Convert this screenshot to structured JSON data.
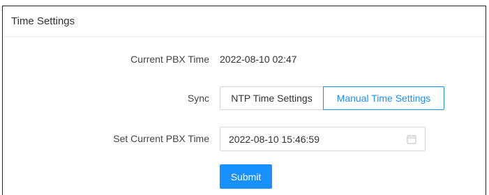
{
  "header": {
    "title": "Time Settings"
  },
  "current_time": {
    "label": "Current PBX Time",
    "value": "2022-08-10 02:47"
  },
  "sync": {
    "label": "Sync",
    "options": [
      "NTP Time Settings",
      "Manual Time Settings"
    ],
    "selected": "Manual Time Settings"
  },
  "set_time": {
    "label": "Set Current PBX Time",
    "value": "2022-08-10 15:46:59",
    "icon": "calendar-icon"
  },
  "actions": {
    "submit_label": "Submit"
  },
  "colors": {
    "accent": "#1890ff",
    "border": "#d9d9d9"
  }
}
